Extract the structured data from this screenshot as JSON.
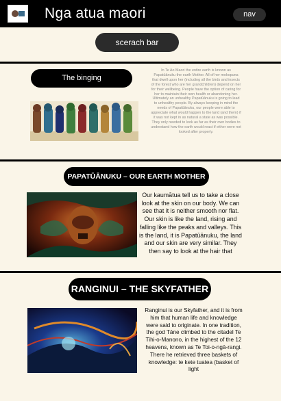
{
  "header": {
    "title": "Nga atua maori",
    "nav_label": "nav",
    "logo_icon": "site-logo-image"
  },
  "search": {
    "label": "scerach bar"
  },
  "binging": {
    "title": "The binging",
    "body": "In Te Ao Maori the entire earth is known as Papatūānuku the earth Mother. All of her mokopuna that dwell upon her (including all the birds and insects of the forest who are her grandchildren) depend on her for their wellbeing. People have the option of caring for her to maintain their own health or abandoning her. Ultimately an unhealthy Papatūānuku is going to lead to unhealthy people. By always keeping in mind the needs of Papatūānuku, our people were able to appreciate what would happen to the land (and them) if it was not kept in as natural a state as was possible. They only needed to look as far as their own bodies to understand how the earth would react if either were not looked after properly."
  },
  "papatuanuku": {
    "title": "PAPATŪĀNUKU – OUR EARTH MOTHER",
    "body": "Our kaumātua tell us to take a close look at the skin on our body. We can see that it is neither smooth nor flat. Our skin is like the land, rising and falling like the peaks and valleys. This is the land, it is Papatūānuku, the land and our skin are very similar. They then say to look at the hair that"
  },
  "ranginui": {
    "title": "RANGINUI – THE SKYFATHER",
    "body": "Ranginui is our Skyfather, and it is from him that human life and knowledge were said to originate. In one tradition, the god Tāne climbed to the citadel Te Tihi-o-Manono, in the highest of the 12 heavens, known as Te Toi-o-ngā-rangi. There he retrieved three baskets of knowledge: te kete tuatea (basket of light"
  },
  "colors": {
    "background": "#faf5e8",
    "header": "#000000",
    "pill": "#000000"
  }
}
